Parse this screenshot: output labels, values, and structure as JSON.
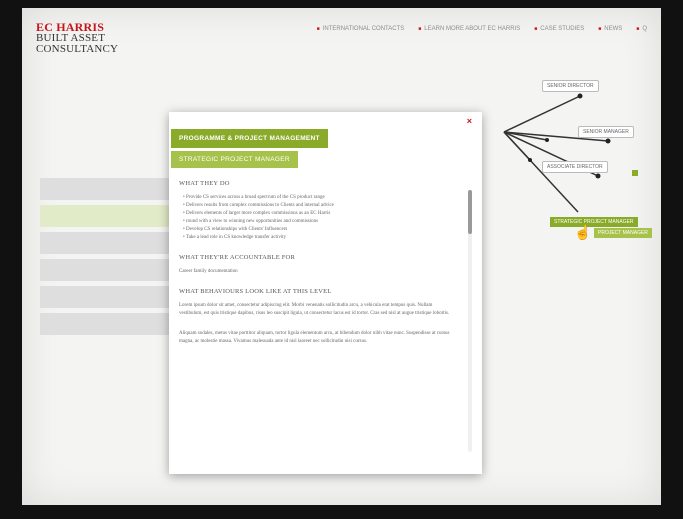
{
  "brand": {
    "line1": "EC HARRIS",
    "line2": "BUILT ASSET",
    "line3": "CONSULTANCY"
  },
  "topnav": [
    {
      "label": "INTERNATIONAL CONTACTS"
    },
    {
      "label": "LEARN MORE ABOUT EC HARRIS"
    },
    {
      "label": "CASE STUDIES"
    },
    {
      "label": "NEWS"
    },
    {
      "label": "Q"
    }
  ],
  "modal": {
    "close": "×",
    "tag_primary": "PROGRAMME & PROJECT MANAGEMENT",
    "tag_secondary": "STRATEGIC PROJECT MANAGER",
    "sections": {
      "what_heading": "WHAT THEY DO",
      "bullets": [
        "Provide CS services across a broad spectrum of the CS product range",
        "Delivers results from complex commissions to Clients and internal advice",
        "Delivers elements of larger more complex commissions as an EC Harris",
        "round with a view to winning new opportunities and commissions",
        "Develop CS relationships with Clients' Influencers",
        "Take a lead role in CS knowledge transfer activity"
      ],
      "accountable_heading": "WHAT THEY'RE ACCOUNTABLE FOR",
      "accountable_text": "Career family documentation",
      "behaviour_heading": "WHAT BEHAVIOURS LOOK LIKE AT THIS LEVEL",
      "para1": "Lorem ipsum dolor sit amet, consectetur adipiscing elit. Morbi venenatis sollicitudin arcu, a vehicula erat tempus quis. Nullam vestibulum, est quis tristique dapibus, risus leo suscipit ligula, ut consectetur lacus est id tortor. Cras sed nisl at augue tristique lobortis.",
      "para2": "Aliquam sodales, metus vitae porttitor aliquam, tortor ligula elementum arcu, at bibendum dolor nibh vitae nunc. Suspendisse at cursus magna, ac molestie massa. Vivamus malesuada ante id nisl laoreet nec sollicitudin nisi cursus."
    }
  },
  "diagram": {
    "nodes": [
      {
        "label": "SENIOR DIRECTOR"
      },
      {
        "label": "SENIOR MANAGER"
      },
      {
        "label": "ASSOCIATE DIRECTOR"
      }
    ],
    "active_line1": "STRATEGIC PROJECT MANAGER",
    "active_line2": "PROJECT MANAGER"
  }
}
